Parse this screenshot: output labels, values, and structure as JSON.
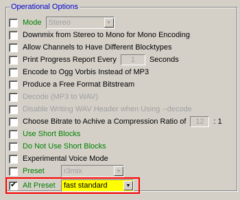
{
  "group": {
    "title": "Operational Options"
  },
  "options": {
    "mode": {
      "label": "Mode",
      "value": "Stereo",
      "checked": false
    },
    "downmix": {
      "label": "Downmix from Stereo to Mono for Mono Encoding",
      "checked": false
    },
    "allow_channels": {
      "label": "Allow Channels to Have Different Blocktypes",
      "checked": false
    },
    "print_progress": {
      "label_before": "Print Progress Report Every",
      "value": "1",
      "label_after": "Seconds",
      "checked": false
    },
    "ogg_vorbis": {
      "label": "Encode to Ogg Vorbis Instead of MP3",
      "checked": false
    },
    "free_format": {
      "label": "Produce a Free Format Bitstream",
      "checked": false
    },
    "decode": {
      "label": "Decode (MP3 to WAV)",
      "checked": false,
      "disabled": true
    },
    "disable_wav_header": {
      "label": "Disable Writing WAV Header when Using --decode",
      "checked": false,
      "disabled": true
    },
    "compression_ratio": {
      "label_before": "Choose Bitrate to Achive a Compression Ratio of",
      "value": "12",
      "label_after": ": 1",
      "checked": false
    },
    "use_short_blocks": {
      "label": "Use Short Blocks",
      "checked": false
    },
    "no_short_blocks": {
      "label": "Do Not Use Short Blocks",
      "checked": false
    },
    "experimental_voice": {
      "label": "Experimental Voice Mode",
      "checked": false
    },
    "preset": {
      "label": "Preset",
      "value": "r3mix",
      "checked": false
    },
    "alt_preset": {
      "label": "Alt Preset",
      "value": "fast standard",
      "checked": true
    }
  },
  "colors": {
    "group_title": "#0000cc",
    "green_label": "#008000",
    "disabled_text": "#a0a0a0",
    "highlight_border": "#ff0000",
    "alt_preset_bg": "#ffff00"
  }
}
